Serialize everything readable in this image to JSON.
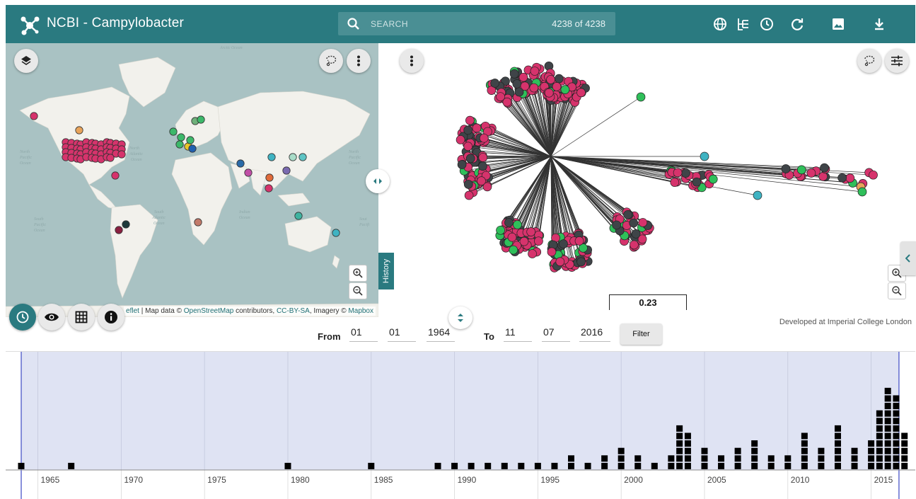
{
  "header": {
    "title": "NCBI - Campylobacter",
    "search_placeholder": "SEARCH",
    "search_count": "4238 of 4238",
    "icons": [
      "logo-icon",
      "search-icon",
      "globe-icon",
      "tree-layout-icon",
      "clock-icon",
      "refresh-icon",
      "image-icon",
      "download-icon"
    ]
  },
  "map": {
    "attribution_prefix": "eflet",
    "attribution_sep": " | Map data © ",
    "osm": "OpenStreetMap",
    "contributors": " contributors, ",
    "license": "CC-BY-SA",
    "imagery": ", Imagery © ",
    "provider": "Mapbox",
    "labels": [
      "Arctic Ocean",
      "North Atlantic Ocean",
      "North Pacific Ocean",
      "South Atlantic Ocean",
      "Indian Ocean",
      "South Pacific Ocean"
    ]
  },
  "tree": {
    "scale_label": "0.23"
  },
  "history_tab": "History",
  "filter": {
    "from_label": "From",
    "to_label": "To",
    "from_day": "01",
    "from_month": "01",
    "from_year": "1964",
    "to_day": "11",
    "to_month": "07",
    "to_year": "2016",
    "button": "Filter"
  },
  "credit": "Developed at Imperial College London",
  "colors": {
    "teal": "#2a7a80",
    "pink": "#d6336c",
    "dark": "#3f4448",
    "green": "#2fbf5a",
    "timeline_bg": "#dfe3f3"
  },
  "timeline": {
    "years": [
      "1965",
      "1970",
      "1975",
      "1980",
      "1985",
      "1990",
      "1995",
      "2000",
      "2005",
      "2010",
      "2015"
    ],
    "counts": [
      [
        1964,
        1
      ],
      [
        1967,
        1
      ],
      [
        1980,
        1
      ],
      [
        1985,
        1
      ],
      [
        1989,
        1
      ],
      [
        1990,
        1
      ],
      [
        1991,
        1
      ],
      [
        1992,
        1
      ],
      [
        1993,
        1
      ],
      [
        1994,
        1
      ],
      [
        1995,
        1
      ],
      [
        1996,
        1
      ],
      [
        1997,
        2
      ],
      [
        1998,
        1
      ],
      [
        1999,
        2
      ],
      [
        2000,
        3
      ],
      [
        2001,
        2
      ],
      [
        2002,
        1
      ],
      [
        2003,
        2
      ],
      [
        2003.5,
        6
      ],
      [
        2004,
        5
      ],
      [
        2005,
        3
      ],
      [
        2006,
        2
      ],
      [
        2007,
        3
      ],
      [
        2008,
        4
      ],
      [
        2009,
        2
      ],
      [
        2010,
        2
      ],
      [
        2011,
        5
      ],
      [
        2012,
        3
      ],
      [
        2013,
        6
      ],
      [
        2014,
        3
      ],
      [
        2015,
        4
      ],
      [
        2015.5,
        8
      ],
      [
        2016,
        11
      ],
      [
        2016.5,
        10
      ],
      [
        2017,
        5
      ]
    ]
  }
}
